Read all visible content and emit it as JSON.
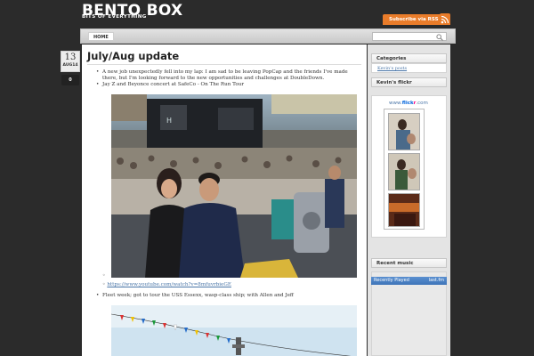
{
  "site": {
    "title": "BENTO BOX",
    "tagline": "BITS OF EVERYTHING",
    "rss_label": "Subscribe via RSS"
  },
  "nav": {
    "home_label": "HOME",
    "search_value": ""
  },
  "post": {
    "date_day": "13",
    "date_month": "AUG14",
    "comments": "0",
    "title": "July/Aug update",
    "bullets": [
      "A new job unexpectedly fell into my lap: I am sad to be leaving PopCap and the friends I've made there, but I'm looking forward to the new opportunities and challenges at DoubleDown.",
      "Jay Z and Beyonce concert at SafeCo - On The Run Tour"
    ],
    "youtube_link": "https://www.youtube.com/watch?v=8mfuvrbieGE",
    "fleet_bullet": "Fleet week; got to tour the USS Essexx, wasp-class ship; with Allen and Jeff"
  },
  "sidebar": {
    "categories_title": "Categories",
    "categories": [
      "Kevin's posts"
    ],
    "flickr_title": "Kevin's flickr",
    "flickr_logo_prefix": "www.",
    "flickr_logo_brand_a": "flick",
    "flickr_logo_brand_b": "r",
    "flickr_logo_suffix": ".com",
    "music_title": "Recent music",
    "lastfm_label": "Recently Played",
    "lastfm_brand": "last.fm"
  },
  "colors": {
    "background": "#2b2b2b",
    "rss": "#e97c2a",
    "link": "#4a76a8"
  }
}
